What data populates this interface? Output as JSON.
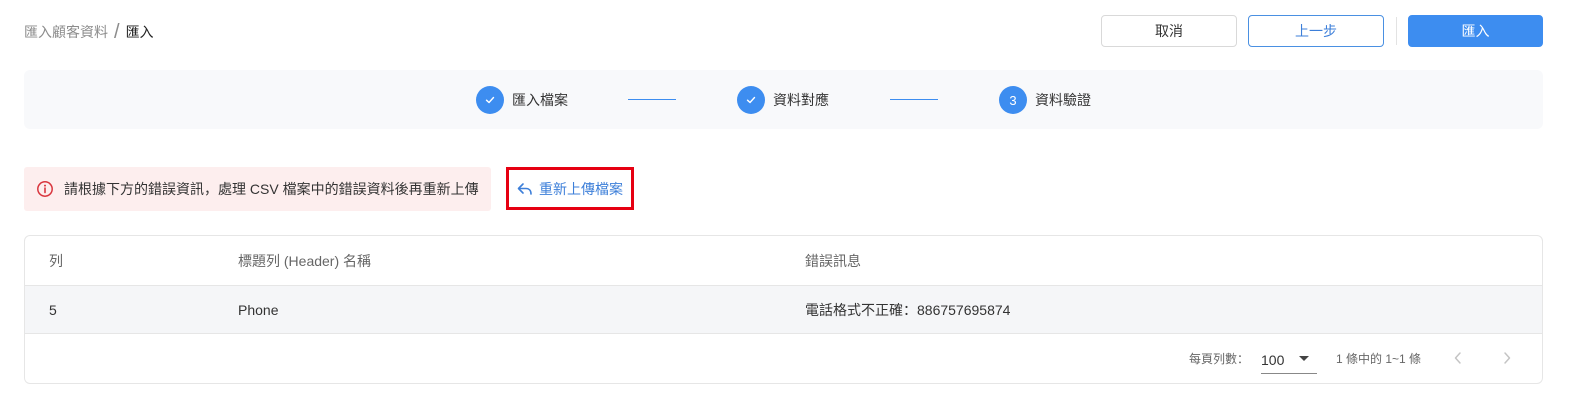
{
  "breadcrumb": {
    "parent": "匯入顧客資料",
    "separator": "/",
    "current": "匯入"
  },
  "actions": {
    "cancel": "取消",
    "back": "上一步",
    "import": "匯入"
  },
  "stepper": {
    "steps": [
      {
        "label": "匯入檔案",
        "state": "done",
        "icon": "check-icon"
      },
      {
        "label": "資料對應",
        "state": "done",
        "icon": "check-icon"
      },
      {
        "label": "資料驗證",
        "state": "active",
        "number": "3"
      }
    ]
  },
  "alert": {
    "icon": "info-circle-icon",
    "text": "請根據下方的錯誤資訊，處理 CSV 檔案中的錯誤資料後再重新上傳"
  },
  "reupload": {
    "icon": "reply-arrow-icon",
    "label": "重新上傳檔案"
  },
  "table": {
    "columns": [
      "列",
      "標題列 (Header) 名稱",
      "錯誤訊息"
    ],
    "rows": [
      [
        "5",
        "Phone",
        "電話格式不正確：886757695874"
      ]
    ]
  },
  "pagination": {
    "rows_per_page_label": "每頁列數：",
    "rows_per_page": "100",
    "range": "1 條中的 1~1 條"
  },
  "colors": {
    "primary": "#3d8df0",
    "alert_bg": "#fdeeee",
    "alert_icon": "#d9363e",
    "highlight": "#e60012"
  }
}
